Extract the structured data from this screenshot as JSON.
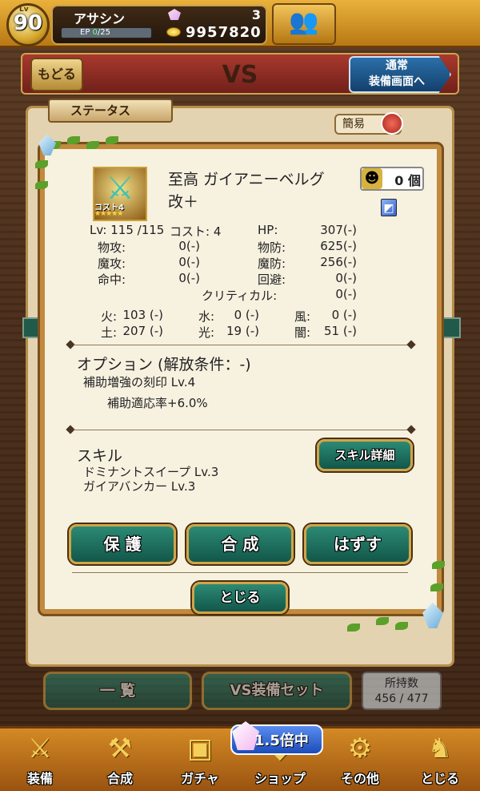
{
  "player": {
    "level_tag": "Lv",
    "level": "90",
    "name": "アサシン",
    "ep_label": "EP",
    "ep_value": "0",
    "ep_max": "/25",
    "gems": "3",
    "coins": "9957820"
  },
  "header": {
    "back_label": "もどる",
    "title": "VS",
    "normal_line1": "通常",
    "normal_line2": "装備画面へ"
  },
  "panel": {
    "status_tab": "ステータス",
    "simple_label": "簡易"
  },
  "item": {
    "name_line1": "至高 ガイアニーベルグ",
    "name_line2": "改＋",
    "cost_label": "コスト4",
    "stars": "★★★★★",
    "count": "0 個",
    "stats": {
      "lv": "Lv: 115 /115",
      "cost": "コスト: 4",
      "hp_label": "HP:",
      "hp": "307(-)",
      "atk_label": "物攻:",
      "atk": "0(-)",
      "def_label": "物防:",
      "def": "625(-)",
      "matk_label": "魔攻:",
      "matk": "0(-)",
      "mdef_label": "魔防:",
      "mdef": "256(-)",
      "hit_label": "命中:",
      "hit": "0(-)",
      "eva_label": "回避:",
      "eva": "0(-)",
      "crit_label": "クリティカル:",
      "crit": "0(-)"
    },
    "elements": {
      "fire_label": "火:",
      "fire": "103 (-)",
      "water_label": "水:",
      "water": "0 (-)",
      "wind_label": "風:",
      "wind": "0 (-)",
      "earth_label": "土:",
      "earth": "207 (-)",
      "light_label": "光:",
      "light": "19 (-)",
      "dark_label": "闇:",
      "dark": "51 (-)"
    },
    "option_title": "オプション (解放条件：-)",
    "options": [
      "補助増強の刻印 Lv.4",
      "補助適応率+6.0%"
    ],
    "skill_title": "スキル",
    "skill_detail_button": "スキル詳細",
    "skills": [
      "ドミナントスイープ  Lv.3",
      "ガイアバンカー  Lv.3"
    ]
  },
  "actions": {
    "protect": "保 護",
    "combine": "合 成",
    "remove": "はずす",
    "close": "とじる"
  },
  "lower": {
    "list": "一 覧",
    "vs_set": "VS装備セット",
    "own_label": "所持数",
    "own_count": "456 / 477"
  },
  "nav": {
    "items": [
      {
        "label": "装備",
        "icon": "equipment-icon"
      },
      {
        "label": "合成",
        "icon": "hammer-icon"
      },
      {
        "label": "ガチャ",
        "icon": "gacha-icon"
      },
      {
        "label": "ショップ",
        "icon": "shop-icon"
      },
      {
        "label": "その他",
        "icon": "gear-icon"
      },
      {
        "label": "とじる",
        "icon": "close-bag-icon"
      }
    ],
    "promo": "1.5倍中"
  }
}
